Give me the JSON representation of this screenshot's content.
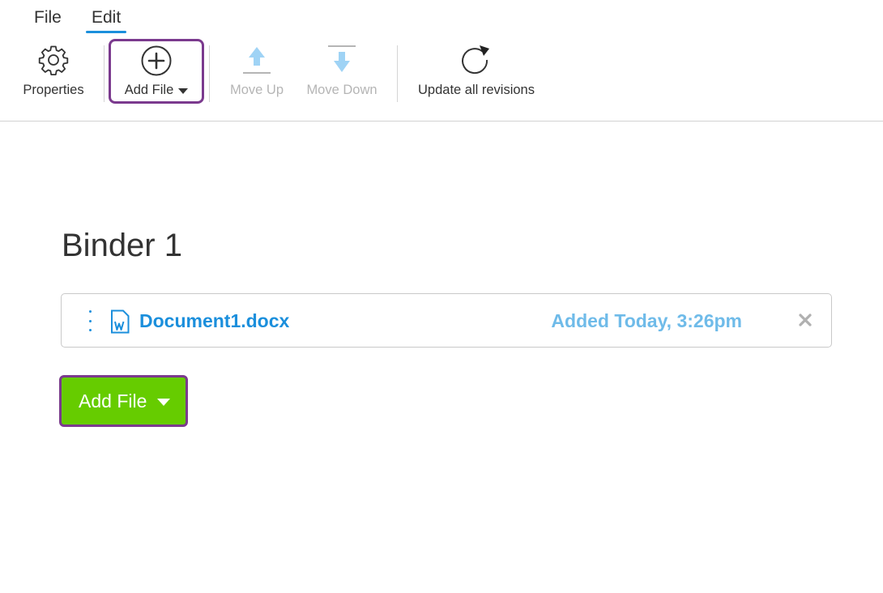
{
  "menu": {
    "file": "File",
    "edit": "Edit"
  },
  "toolbar": {
    "properties": {
      "label": "Properties",
      "icon": "gear-icon"
    },
    "add_file": {
      "label": "Add File",
      "icon": "plus-circle-icon"
    },
    "move_up": {
      "label": "Move Up",
      "icon": "arrow-up-icon",
      "disabled": true
    },
    "move_down": {
      "label": "Move Down",
      "icon": "arrow-down-icon",
      "disabled": true
    },
    "update_revisions": {
      "label": "Update all revisions",
      "icon": "refresh-icon"
    }
  },
  "binder": {
    "title": "Binder 1",
    "files": [
      {
        "name": "Document1.docx",
        "added": "Added Today, 3:26pm",
        "icon": "word-document-icon"
      }
    ],
    "add_button_label": "Add File"
  },
  "colors": {
    "accent_blue": "#1b8fdc",
    "light_blue": "#6fbbe9",
    "green_button": "#66cc00",
    "focus_purple": "#7b3a8e",
    "disabled_icon": "#9fd3f5"
  }
}
